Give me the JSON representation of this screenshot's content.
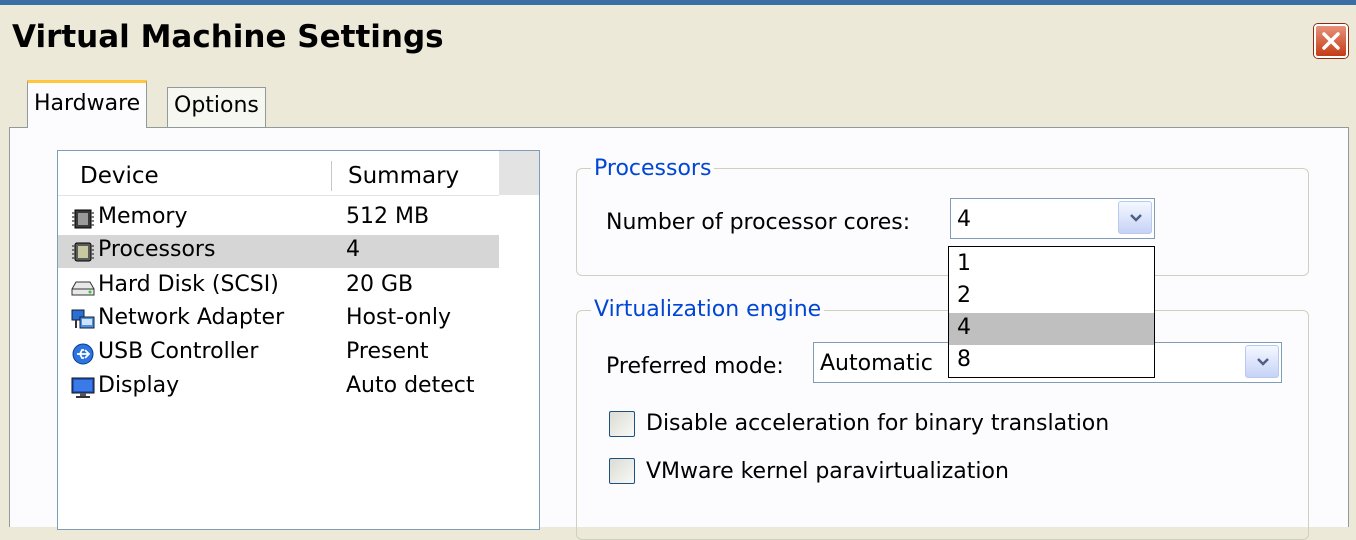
{
  "window": {
    "title": "Virtual Machine Settings"
  },
  "tabs": [
    {
      "label": "Hardware",
      "active": true
    },
    {
      "label": "Options",
      "active": false
    }
  ],
  "device_list": {
    "columns": [
      "Device",
      "Summary"
    ],
    "rows": [
      {
        "device": "Memory",
        "summary": "512 MB",
        "icon": "memory-chip-icon"
      },
      {
        "device": "Processors",
        "summary": "4",
        "icon": "processor-chip-icon",
        "selected": true
      },
      {
        "device": "Hard Disk (SCSI)",
        "summary": "20 GB",
        "icon": "hard-disk-icon"
      },
      {
        "device": "Network Adapter",
        "summary": "Host-only",
        "icon": "network-adapter-icon"
      },
      {
        "device": "USB Controller",
        "summary": "Present",
        "icon": "usb-icon"
      },
      {
        "device": "Display",
        "summary": "Auto detect",
        "icon": "monitor-icon"
      }
    ]
  },
  "processors": {
    "legend": "Processors",
    "cores_label": "Number of processor cores:",
    "cores_value": "4",
    "cores_options": [
      "1",
      "2",
      "4",
      "8"
    ]
  },
  "virtualization": {
    "legend": "Virtualization engine",
    "mode_label": "Preferred mode:",
    "mode_value": "Automatic",
    "checkboxes": [
      {
        "label": "Disable acceleration for binary translation",
        "checked": false
      },
      {
        "label": "VMware kernel paravirtualization",
        "checked": false
      }
    ]
  },
  "colors": {
    "legend": "#0046d5",
    "selected_row": "#d6d6d6",
    "dropdown_highlight": "#bfbfbf",
    "close_button": "#c43b15"
  }
}
